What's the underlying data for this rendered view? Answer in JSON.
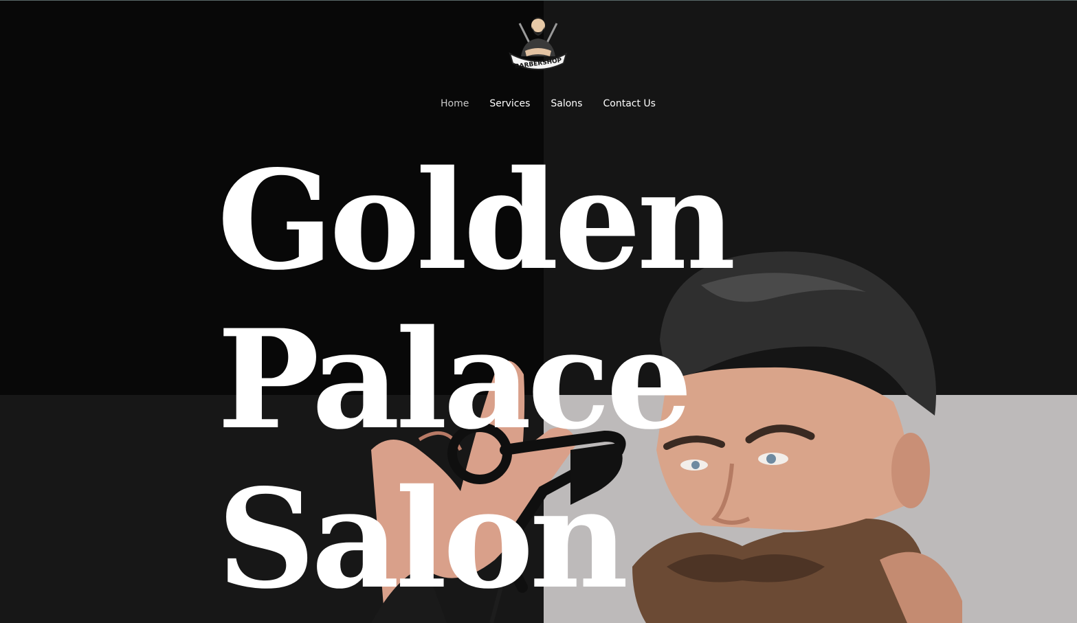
{
  "logo": {
    "text": "BARBERSHOP"
  },
  "nav": {
    "items": [
      {
        "label": "Home",
        "active": true
      },
      {
        "label": "Services",
        "active": false
      },
      {
        "label": "Salons",
        "active": false
      },
      {
        "label": "Contact Us",
        "active": false
      }
    ]
  },
  "hero": {
    "lines": [
      "Golden",
      "Palace",
      "Salon"
    ]
  },
  "colors": {
    "background_dark": "#080808",
    "panel_dark": "#151515",
    "panel_light": "#bdbaba",
    "text": "#ffffff",
    "nav_active": "#c9c9c9"
  },
  "icons": {
    "logo": "barber-logo-icon",
    "scissors": "scissors-icon"
  }
}
